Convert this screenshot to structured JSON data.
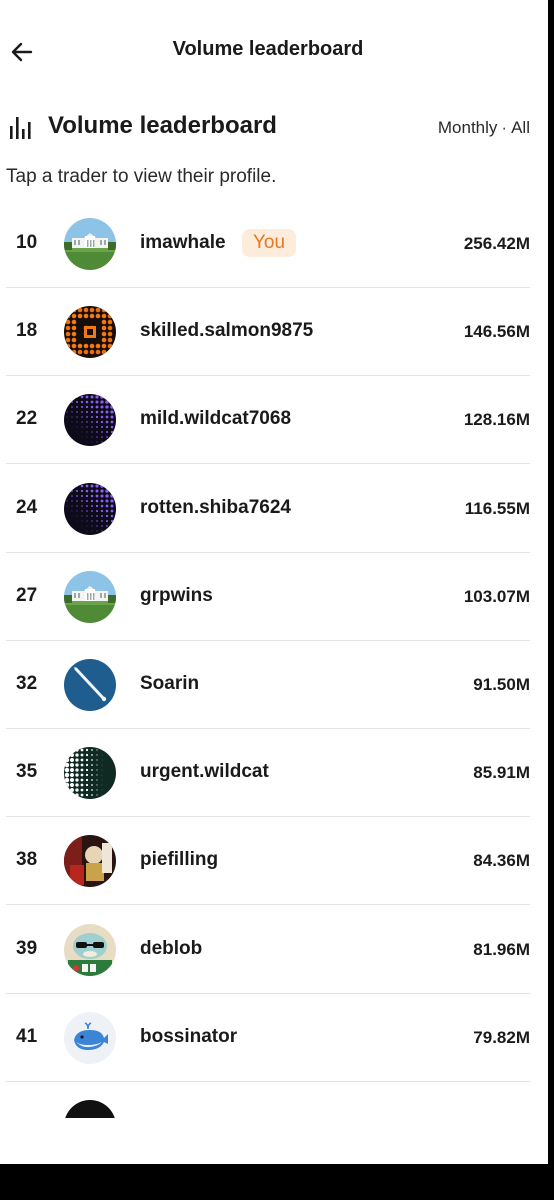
{
  "nav": {
    "title": "Volume leaderboard"
  },
  "header": {
    "title": "Volume leaderboard",
    "period": "Monthly",
    "separator": "·",
    "scope": "All"
  },
  "subtitle": "Tap a trader to view their profile.",
  "you_label": "You",
  "traders": [
    {
      "rank": "10",
      "name": "imawhale",
      "volume": "256.42M",
      "avatar": "white-house",
      "is_you": true
    },
    {
      "rank": "18",
      "name": "skilled.salmon9875",
      "volume": "146.56M",
      "avatar": "orange-dots",
      "is_you": false
    },
    {
      "rank": "22",
      "name": "mild.wildcat7068",
      "volume": "128.16M",
      "avatar": "purple-halftone",
      "is_you": false
    },
    {
      "rank": "24",
      "name": "rotten.shiba7624",
      "volume": "116.55M",
      "avatar": "purple-halftone",
      "is_you": false
    },
    {
      "rank": "27",
      "name": "grpwins",
      "volume": "103.07M",
      "avatar": "white-house",
      "is_you": false
    },
    {
      "rank": "32",
      "name": "Soarin",
      "volume": "91.50M",
      "avatar": "blue-contrail",
      "is_you": false
    },
    {
      "rank": "35",
      "name": "urgent.wildcat",
      "volume": "85.91M",
      "avatar": "white-halftone",
      "is_you": false
    },
    {
      "rank": "38",
      "name": "piefilling",
      "volume": "84.36M",
      "avatar": "red-figure",
      "is_you": false
    },
    {
      "rank": "39",
      "name": "deblob",
      "volume": "81.96M",
      "avatar": "green-cartoon",
      "is_you": false
    },
    {
      "rank": "41",
      "name": "bossinator",
      "volume": "79.82M",
      "avatar": "whale-icon",
      "is_you": false
    }
  ],
  "colors": {
    "you_badge_bg": "#fdebdc",
    "you_badge_text": "#e8761e",
    "divider": "#e4e4e4"
  }
}
